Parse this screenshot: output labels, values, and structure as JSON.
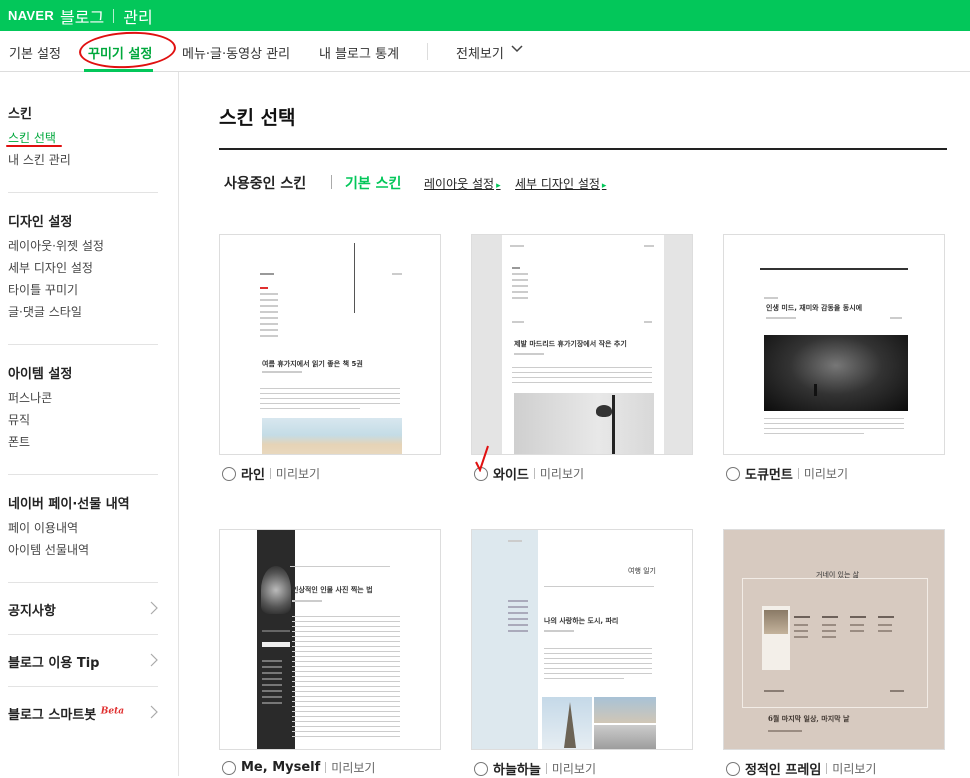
{
  "topbar": {
    "naver": "NAVER",
    "blog": "블로그",
    "admin": "관리"
  },
  "nav": {
    "tabs": [
      "기본 설정",
      "꾸미기 설정",
      "메뉴·글·동영상 관리",
      "내 블로그 통계",
      "전체보기"
    ]
  },
  "sidebar": {
    "skin_heading": "스킨",
    "skin_items": [
      "스킨 선택",
      "내 스킨 관리"
    ],
    "design_heading": "디자인 설정",
    "design_items": [
      "레이아웃·위젯 설정",
      "세부 디자인 설정",
      "타이틀 꾸미기",
      "글·댓글 스타일"
    ],
    "item_heading": "아이템 설정",
    "item_items": [
      "퍼스나콘",
      "뮤직",
      "폰트"
    ],
    "pay_heading": "네이버 페이·선물 내역",
    "pay_items": [
      "페이 이용내역",
      "아이템 선물내역"
    ],
    "links": [
      "공지사항",
      "블로그 이용 Tip",
      "블로그 스마트봇"
    ],
    "beta": "Beta"
  },
  "main": {
    "title": "스킨 선택",
    "tab_using": "사용중인 스킨",
    "tab_base": "기본 스킨",
    "link_layout": "레이아웃 설정",
    "link_detail": "세부 디자인 설정",
    "preview_label": "미리보기",
    "skins": [
      {
        "name": "라인"
      },
      {
        "name": "와이드"
      },
      {
        "name": "도큐먼트"
      },
      {
        "name": "Me, Myself"
      },
      {
        "name": "하늘하늘"
      },
      {
        "name": "정적인 프레임"
      }
    ]
  },
  "thumb_text": {
    "line_title": "여름 휴가지에서 읽기 좋은 책 5권",
    "wide_title": "제발 마드리드 휴가기장에서 작은 추기",
    "doc_title": "인생 미드, 재미와 감동을 동시에",
    "me_title": "인상적인 인물 사진 찍는 법",
    "sky_top": "여행 일기",
    "sky_title": "나의 사랑하는 도시, 파리",
    "frame_top": "거네이 있는 삶",
    "frame_title": "6월 마지막 일상, 마지막 날"
  },
  "colors": {
    "brand": "#03c75a",
    "annotation": "#e01010"
  }
}
